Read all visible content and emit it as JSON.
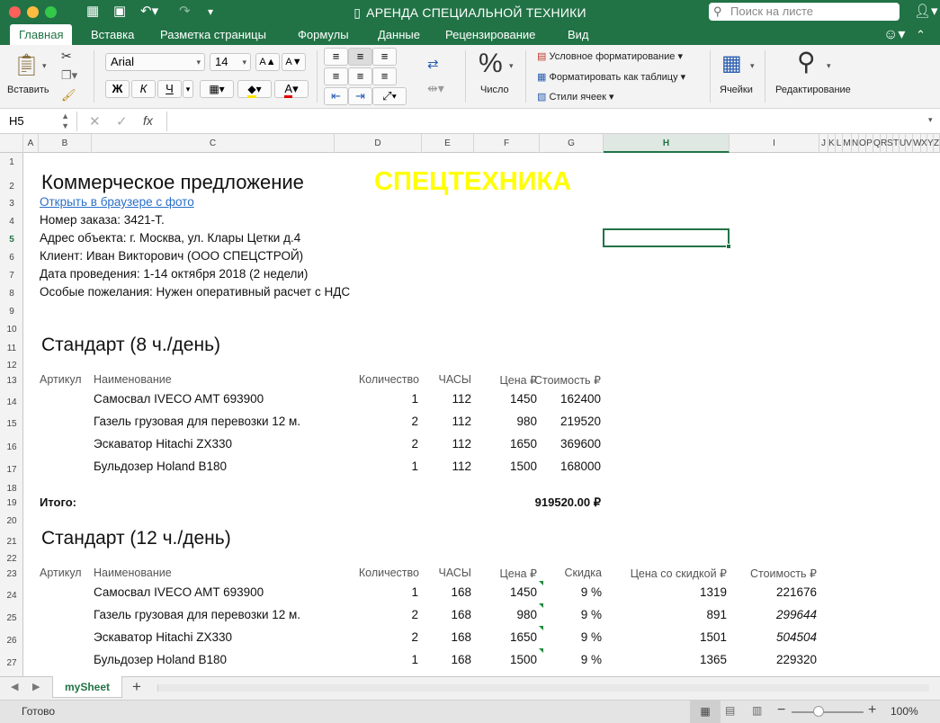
{
  "window": {
    "title": "АРЕНДА СПЕЦИАЛЬНОЙ ТЕХНИКИ",
    "search_placeholder": "Поиск на листе"
  },
  "tabs": [
    "Главная",
    "Вставка",
    "Разметка страницы",
    "Формулы",
    "Данные",
    "Рецензирование",
    "Вид"
  ],
  "ribbon": {
    "paste_label": "Вставить",
    "font_name": "Arial",
    "font_size": "14",
    "bold": "Ж",
    "italic": "К",
    "underline": "Ч",
    "grow_font": "A▲",
    "shrink_font": "A▼",
    "fill_letter": "A",
    "number_label": "Число",
    "cond_format": "Условное форматирование",
    "format_table": "Форматировать как таблицу",
    "cell_styles": "Стили ячеек",
    "cells_label": "Ячейки",
    "editing_label": "Редактирование"
  },
  "formula_bar": {
    "name_box": "H5",
    "fx": "fx",
    "formula": ""
  },
  "columns": [
    "A",
    "B",
    "C",
    "D",
    "E",
    "F",
    "G",
    "H",
    "I",
    "J",
    "K",
    "L",
    "M",
    "N",
    "O",
    "P",
    "Q",
    "R",
    "S",
    "T",
    "U",
    "V",
    "W",
    "X",
    "Y",
    "Z"
  ],
  "rows": [
    "1",
    "2",
    "3",
    "4",
    "5",
    "6",
    "7",
    "8",
    "9",
    "10",
    "11",
    "12",
    "13",
    "14",
    "15",
    "16",
    "17",
    "18",
    "19",
    "20",
    "21",
    "22",
    "23",
    "24",
    "25",
    "26",
    "27"
  ],
  "sheet": {
    "title": "Коммерческое предложение",
    "brand": "СПЕЦТЕХНИКА",
    "brand_color": "#ffff00",
    "link": "Открыть в браузере с фото",
    "info": [
      "Номер заказа: 3421-Т.",
      "Адрес объекта: г. Москва, ул. Клары Цетки д.4",
      "Клиент: Иван Викторович (ООО СПЕЦСТРОЙ)",
      "Дата проведения: 1-14 октября 2018 (2 недели)",
      "Особые пожелания: Нужен оперативный расчет с НДС"
    ],
    "section1": {
      "title": "Стандарт (8 ч./день)",
      "headers": [
        "Артикул",
        "Наименование",
        "Количество",
        "ЧАСЫ",
        "Цена ₽",
        "Стоимость ₽"
      ],
      "rows": [
        [
          "Самосвал IVECO AMT 693900",
          "1",
          "112",
          "1450",
          "162400"
        ],
        [
          "Газель грузовая для перевозки 12 м.",
          "2",
          "112",
          "980",
          "219520"
        ],
        [
          "Эскаватор Hitachi ZX330",
          "2",
          "112",
          "1650",
          "369600"
        ],
        [
          "Бульдозер Holand B180",
          "1",
          "112",
          "1500",
          "168000"
        ]
      ],
      "total_label": "Итого:",
      "total_value": "919520.00 ₽"
    },
    "section2": {
      "title": "Стандарт (12 ч./день)",
      "headers": [
        "Артикул",
        "Наименование",
        "Количество",
        "ЧАСЫ",
        "Цена ₽",
        "Скидка",
        "Цена со скидкой ₽",
        "Стоимость ₽"
      ],
      "rows": [
        [
          "Самосвал IVECO AMT 693900",
          "1",
          "168",
          "1450",
          "9 %",
          "1319",
          "221676"
        ],
        [
          "Газель грузовая для перевозки 12 м.",
          "2",
          "168",
          "980",
          "9 %",
          "891",
          "299644"
        ],
        [
          "Эскаватор Hitachi ZX330",
          "2",
          "168",
          "1650",
          "9 %",
          "1501",
          "504504"
        ],
        [
          "Бульдозер Holand B180",
          "1",
          "168",
          "1500",
          "9 %",
          "1365",
          "229320"
        ]
      ]
    }
  },
  "sheet_tabs": {
    "active": "mySheet",
    "add": "+"
  },
  "status": {
    "ready": "Готово",
    "zoom": "100%"
  },
  "colors": {
    "accent": "#217346",
    "link": "#2a6fc9"
  }
}
